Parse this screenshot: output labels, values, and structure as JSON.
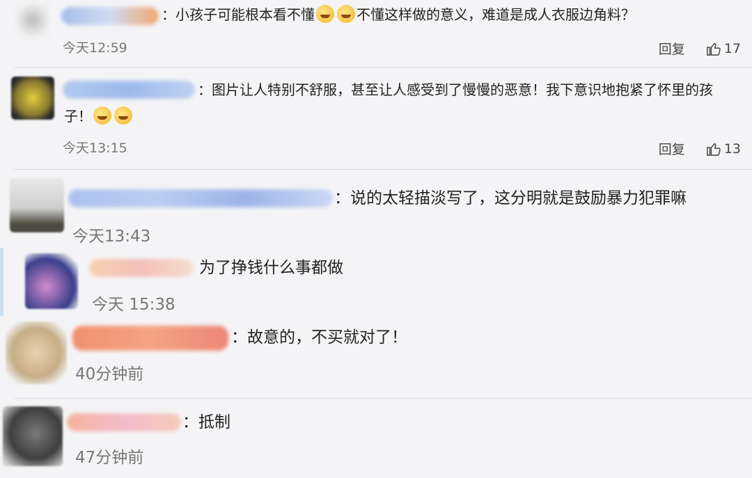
{
  "comments": [
    {
      "text": "小孩子可能根本看不懂",
      "text2": "不懂这样做的意义，难道是成人衣服边角料？",
      "time": "今天12:59",
      "reply": "回复",
      "likes": "17"
    },
    {
      "text": "图片让人特别不舒服，甚至让人感受到了慢慢的恶意！我下意识地抱紧了怀里的孩",
      "text_line2": "子！",
      "time": "今天13:15",
      "reply": "回复",
      "likes": "13"
    },
    {
      "text": "说的太轻描淡写了，这分明就是鼓励暴力犯罪嘛",
      "time": "今天13:43"
    },
    {
      "text": "为了挣钱什么事都做",
      "time": "今天 15:38"
    },
    {
      "text": "故意的，不买就对了！",
      "time": "40分钟前"
    },
    {
      "text": "抵制",
      "time": "47分钟前"
    }
  ],
  "colon": "：",
  "icons": [
    "like-icon",
    "crying-emoji-icon",
    "laughing-emoji-icon"
  ]
}
